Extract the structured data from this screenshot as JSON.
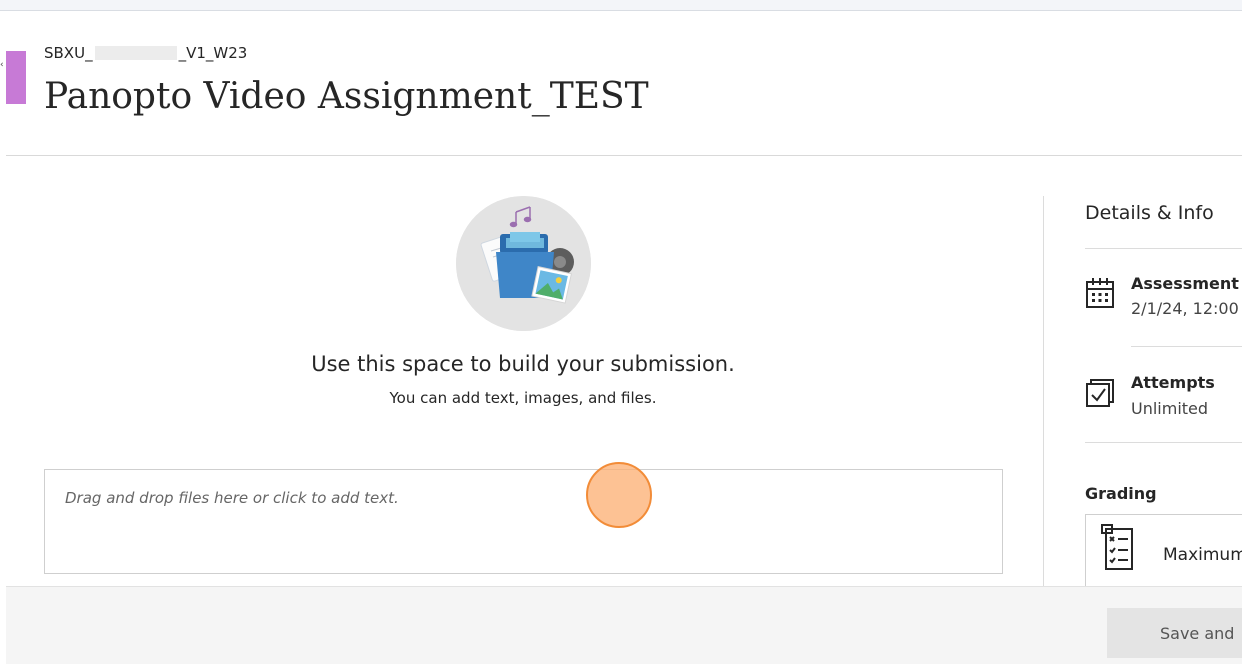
{
  "header": {
    "course_prefix": "SBXU_",
    "course_suffix": "_V1_W23",
    "title": "Panopto Video Assignment_TEST"
  },
  "submission": {
    "heading": "Use this space to build your submission.",
    "subheading": "You can add text, images, and files.",
    "dropzone_placeholder": "Drag and drop files here or click to add text."
  },
  "details": {
    "title": "Details & Info",
    "items": [
      {
        "label": "Assessment",
        "value": "2/1/24, 12:00",
        "icon": "calendar-icon"
      },
      {
        "label": "Attempts",
        "value": "Unlimited",
        "icon": "attempts-checkbox-icon"
      }
    ],
    "grading_label": "Grading",
    "grading_box_text": "Maximum",
    "grading_icon": "rubric-list-icon"
  },
  "footer": {
    "save_label": "Save and"
  },
  "colors": {
    "accent": "#c77ad6",
    "cursor_highlight": "#fcad70",
    "illustration_bg": "#e3e3e3"
  }
}
